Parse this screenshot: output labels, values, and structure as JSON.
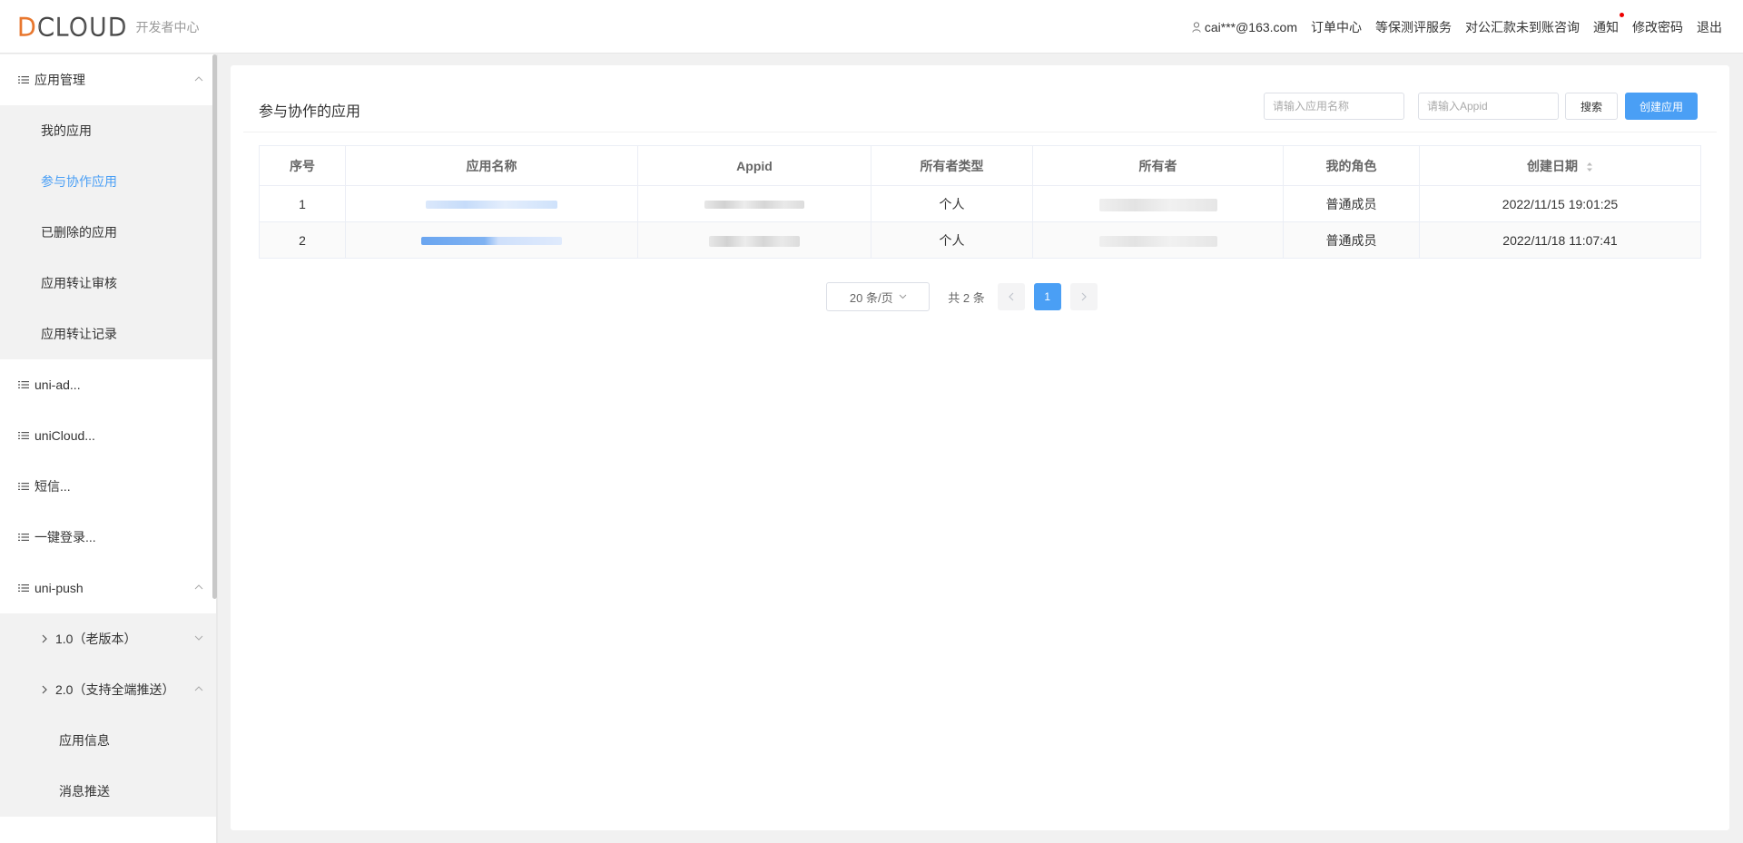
{
  "header": {
    "logo_text_d": "D",
    "logo_text_rest": "CLOUD",
    "logo_subtitle": "开发者中心",
    "user_email": "cai***@163.com",
    "nav": [
      "订单中心",
      "等保测评服务",
      "对公汇款未到账咨询",
      "通知",
      "修改密码",
      "退出"
    ]
  },
  "sidebar": {
    "app_mgmt": "应用管理",
    "app_mgmt_items": [
      "我的应用",
      "参与协作应用",
      "已删除的应用",
      "应用转让审核",
      "应用转让记录"
    ],
    "uni_ad": "uni-ad...",
    "unicloud": "uniCloud...",
    "sms": "短信...",
    "onekey": "一键登录...",
    "uni_push": "uni-push",
    "push_v1": "1.0（老版本）",
    "push_v2": "2.0（支持全端推送）",
    "push_v2_items": [
      "应用信息",
      "消息推送"
    ]
  },
  "main": {
    "title": "参与协作的应用",
    "search_name_placeholder": "请输入应用名称",
    "search_appid_placeholder": "请输入Appid",
    "search_button": "搜索",
    "create_button": "创建应用"
  },
  "table": {
    "columns": [
      "序号",
      "应用名称",
      "Appid",
      "所有者类型",
      "所有者",
      "我的角色",
      "创建日期"
    ],
    "rows": [
      {
        "index": "1",
        "owner_type": "个人",
        "role": "普通成员",
        "created": "2022/11/15 19:01:25"
      },
      {
        "index": "2",
        "owner_type": "个人",
        "role": "普通成员",
        "created": "2022/11/18 11:07:41"
      }
    ]
  },
  "pagination": {
    "page_size": "20 条/页",
    "total": "共 2 条",
    "current_page": "1"
  },
  "colors": {
    "accent": "#4a9ff5",
    "logo_orange": "#e8772e",
    "notification_dot": "#ee0000"
  }
}
